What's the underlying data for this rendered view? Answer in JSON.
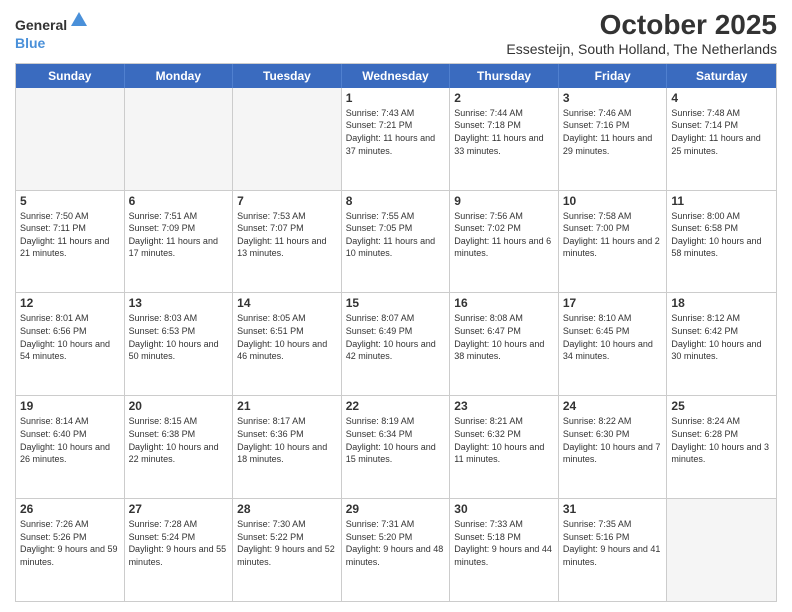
{
  "header": {
    "logo_general": "General",
    "logo_blue": "Blue",
    "title": "October 2025",
    "subtitle": "Essesteijn, South Holland, The Netherlands"
  },
  "days_of_week": [
    "Sunday",
    "Monday",
    "Tuesday",
    "Wednesday",
    "Thursday",
    "Friday",
    "Saturday"
  ],
  "weeks": [
    [
      {
        "day": "",
        "empty": true
      },
      {
        "day": "",
        "empty": true
      },
      {
        "day": "",
        "empty": true
      },
      {
        "day": "1",
        "sunrise": "7:43 AM",
        "sunset": "7:21 PM",
        "daylight": "11 hours and 37 minutes."
      },
      {
        "day": "2",
        "sunrise": "7:44 AM",
        "sunset": "7:18 PM",
        "daylight": "11 hours and 33 minutes."
      },
      {
        "day": "3",
        "sunrise": "7:46 AM",
        "sunset": "7:16 PM",
        "daylight": "11 hours and 29 minutes."
      },
      {
        "day": "4",
        "sunrise": "7:48 AM",
        "sunset": "7:14 PM",
        "daylight": "11 hours and 25 minutes."
      }
    ],
    [
      {
        "day": "5",
        "sunrise": "7:50 AM",
        "sunset": "7:11 PM",
        "daylight": "11 hours and 21 minutes."
      },
      {
        "day": "6",
        "sunrise": "7:51 AM",
        "sunset": "7:09 PM",
        "daylight": "11 hours and 17 minutes."
      },
      {
        "day": "7",
        "sunrise": "7:53 AM",
        "sunset": "7:07 PM",
        "daylight": "11 hours and 13 minutes."
      },
      {
        "day": "8",
        "sunrise": "7:55 AM",
        "sunset": "7:05 PM",
        "daylight": "11 hours and 10 minutes."
      },
      {
        "day": "9",
        "sunrise": "7:56 AM",
        "sunset": "7:02 PM",
        "daylight": "11 hours and 6 minutes."
      },
      {
        "day": "10",
        "sunrise": "7:58 AM",
        "sunset": "7:00 PM",
        "daylight": "11 hours and 2 minutes."
      },
      {
        "day": "11",
        "sunrise": "8:00 AM",
        "sunset": "6:58 PM",
        "daylight": "10 hours and 58 minutes."
      }
    ],
    [
      {
        "day": "12",
        "sunrise": "8:01 AM",
        "sunset": "6:56 PM",
        "daylight": "10 hours and 54 minutes."
      },
      {
        "day": "13",
        "sunrise": "8:03 AM",
        "sunset": "6:53 PM",
        "daylight": "10 hours and 50 minutes."
      },
      {
        "day": "14",
        "sunrise": "8:05 AM",
        "sunset": "6:51 PM",
        "daylight": "10 hours and 46 minutes."
      },
      {
        "day": "15",
        "sunrise": "8:07 AM",
        "sunset": "6:49 PM",
        "daylight": "10 hours and 42 minutes."
      },
      {
        "day": "16",
        "sunrise": "8:08 AM",
        "sunset": "6:47 PM",
        "daylight": "10 hours and 38 minutes."
      },
      {
        "day": "17",
        "sunrise": "8:10 AM",
        "sunset": "6:45 PM",
        "daylight": "10 hours and 34 minutes."
      },
      {
        "day": "18",
        "sunrise": "8:12 AM",
        "sunset": "6:42 PM",
        "daylight": "10 hours and 30 minutes."
      }
    ],
    [
      {
        "day": "19",
        "sunrise": "8:14 AM",
        "sunset": "6:40 PM",
        "daylight": "10 hours and 26 minutes."
      },
      {
        "day": "20",
        "sunrise": "8:15 AM",
        "sunset": "6:38 PM",
        "daylight": "10 hours and 22 minutes."
      },
      {
        "day": "21",
        "sunrise": "8:17 AM",
        "sunset": "6:36 PM",
        "daylight": "10 hours and 18 minutes."
      },
      {
        "day": "22",
        "sunrise": "8:19 AM",
        "sunset": "6:34 PM",
        "daylight": "10 hours and 15 minutes."
      },
      {
        "day": "23",
        "sunrise": "8:21 AM",
        "sunset": "6:32 PM",
        "daylight": "10 hours and 11 minutes."
      },
      {
        "day": "24",
        "sunrise": "8:22 AM",
        "sunset": "6:30 PM",
        "daylight": "10 hours and 7 minutes."
      },
      {
        "day": "25",
        "sunrise": "8:24 AM",
        "sunset": "6:28 PM",
        "daylight": "10 hours and 3 minutes."
      }
    ],
    [
      {
        "day": "26",
        "sunrise": "7:26 AM",
        "sunset": "5:26 PM",
        "daylight": "9 hours and 59 minutes."
      },
      {
        "day": "27",
        "sunrise": "7:28 AM",
        "sunset": "5:24 PM",
        "daylight": "9 hours and 55 minutes."
      },
      {
        "day": "28",
        "sunrise": "7:30 AM",
        "sunset": "5:22 PM",
        "daylight": "9 hours and 52 minutes."
      },
      {
        "day": "29",
        "sunrise": "7:31 AM",
        "sunset": "5:20 PM",
        "daylight": "9 hours and 48 minutes."
      },
      {
        "day": "30",
        "sunrise": "7:33 AM",
        "sunset": "5:18 PM",
        "daylight": "9 hours and 44 minutes."
      },
      {
        "day": "31",
        "sunrise": "7:35 AM",
        "sunset": "5:16 PM",
        "daylight": "9 hours and 41 minutes."
      },
      {
        "day": "",
        "empty": true
      }
    ]
  ]
}
